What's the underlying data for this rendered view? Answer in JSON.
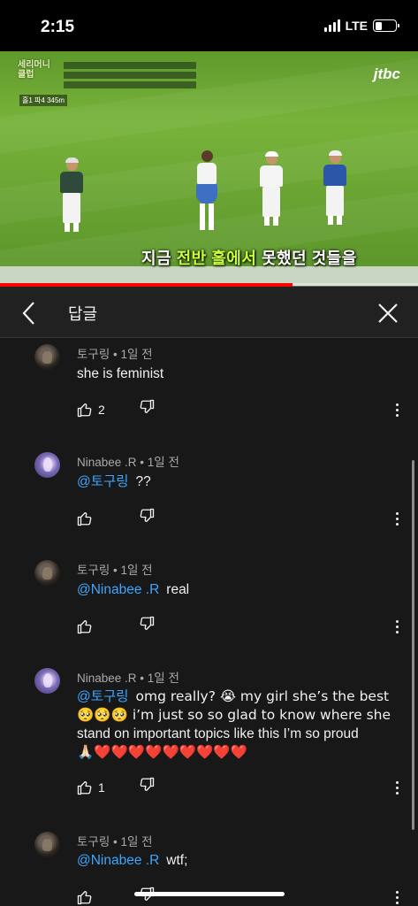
{
  "status_bar": {
    "time": "2:15",
    "network": "LTE",
    "battery_level": 0.35
  },
  "video": {
    "show_logo_lines": [
      "세리머니",
      "클럽"
    ],
    "hole_tag": "홀1 파4 345m",
    "channel": "jtbc",
    "caption_prefix": "지금 ",
    "caption_highlight": "전반 홀에서",
    "caption_suffix": " 못했던 것들을",
    "progress": 0.7
  },
  "panel": {
    "title": "답글"
  },
  "comments": [
    {
      "author_meta": "토구링 • 1일 전",
      "mention": "",
      "text": "she is feminist",
      "likes": "2",
      "avatar": "dark"
    },
    {
      "author_meta": "Ninabee .R • 1일 전",
      "mention": "@토구링",
      "text": "??",
      "likes": "",
      "avatar": "purple"
    },
    {
      "author_meta": "토구링 • 1일 전",
      "mention": "@Ninabee .R",
      "text": "real",
      "likes": "",
      "avatar": "dark"
    },
    {
      "author_meta": "Ninabee .R • 1일 전",
      "mention": "@토구링",
      "text_line1": "omg really? 😭 my girl she’s the best",
      "text_line2": "🥺🥺🥺 i’m just so so glad to know where she",
      "text_line3": "stand on important topics like this I’m so proud",
      "text_line4": "🙏🏻❤️❤️❤️❤️❤️❤️❤️❤️❤️",
      "likes": "1",
      "avatar": "purple"
    },
    {
      "author_meta": "토구링 • 1일 전",
      "mention": "@Ninabee .R",
      "text": "wtf;",
      "likes": "",
      "avatar": "dark"
    }
  ],
  "colors": {
    "background": "#181818",
    "mention": "#3ea6ff",
    "progress": "#ff0000",
    "heart": "#e8111b"
  }
}
